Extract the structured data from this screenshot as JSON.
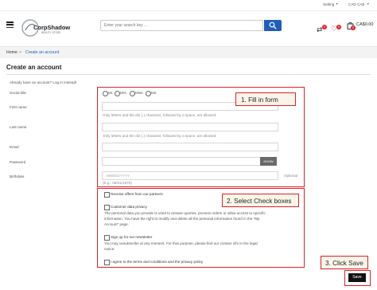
{
  "topbar": {
    "setting_label": "Setting",
    "currency_label": "CAD CA$"
  },
  "header": {
    "logo_text": "CorpShadow",
    "logo_tagline": "BEAUTY STORE",
    "search_placeholder": "Enter your search key ...",
    "cart_total": "CA$0.00",
    "compare_count": "0",
    "wishlist_count": "0",
    "cart_count": "0"
  },
  "breadcrumb": {
    "home": "Home",
    "separator": ">",
    "current": "Create an account"
  },
  "page": {
    "title": "Create an account",
    "login_prompt": "Already have an account? Log in instead!"
  },
  "form": {
    "social_title_label": "Social title",
    "social_titles": [
      "Mr.",
      "Mrs.",
      "Miss.",
      "Ms."
    ],
    "first_name_label": "First name",
    "first_name_hint": "Only letters and the dot (.) character, followed by a space, are allowed.",
    "last_name_label": "Last name",
    "last_name_hint": "Only letters and the dot (.) character, followed by a space, are allowed.",
    "email_label": "Email",
    "password_label": "Password",
    "show_button": "SHOW",
    "birthdate_label": "Birthdate",
    "birthdate_placeholder": "MM/DD/YYYY",
    "birthdate_example": "(E.g.: 05/31/1970)",
    "optional_label": "Optional"
  },
  "checkboxes": {
    "offers": "Receive offers from our partners",
    "privacy_title": "Customer data privacy",
    "privacy_text_1": "The personal data you provide is used to answer queries, process orders or allow access to specific",
    "privacy_text_2": "information. You have the right to modify and delete all the personal information found in the \"My",
    "privacy_text_3": "Account\" page.",
    "newsletter_title": "Sign up for our newsletter",
    "newsletter_text_1": "You may unsubscribe at any moment. For that purpose, please find our contact info in the legal",
    "newsletter_text_2": "notice.",
    "terms": "I agree to the terms and conditions and the privacy policy"
  },
  "save_button": "Save",
  "callouts": {
    "step1": "1. Fill in form",
    "step2": "2. Select Check boxes",
    "step3": "3. Click Save"
  },
  "colors": {
    "accent_blue": "#1f5fb8",
    "callout_red": "#e0202a",
    "callout_bg": "#fbf5e9",
    "save_black": "#111111"
  }
}
